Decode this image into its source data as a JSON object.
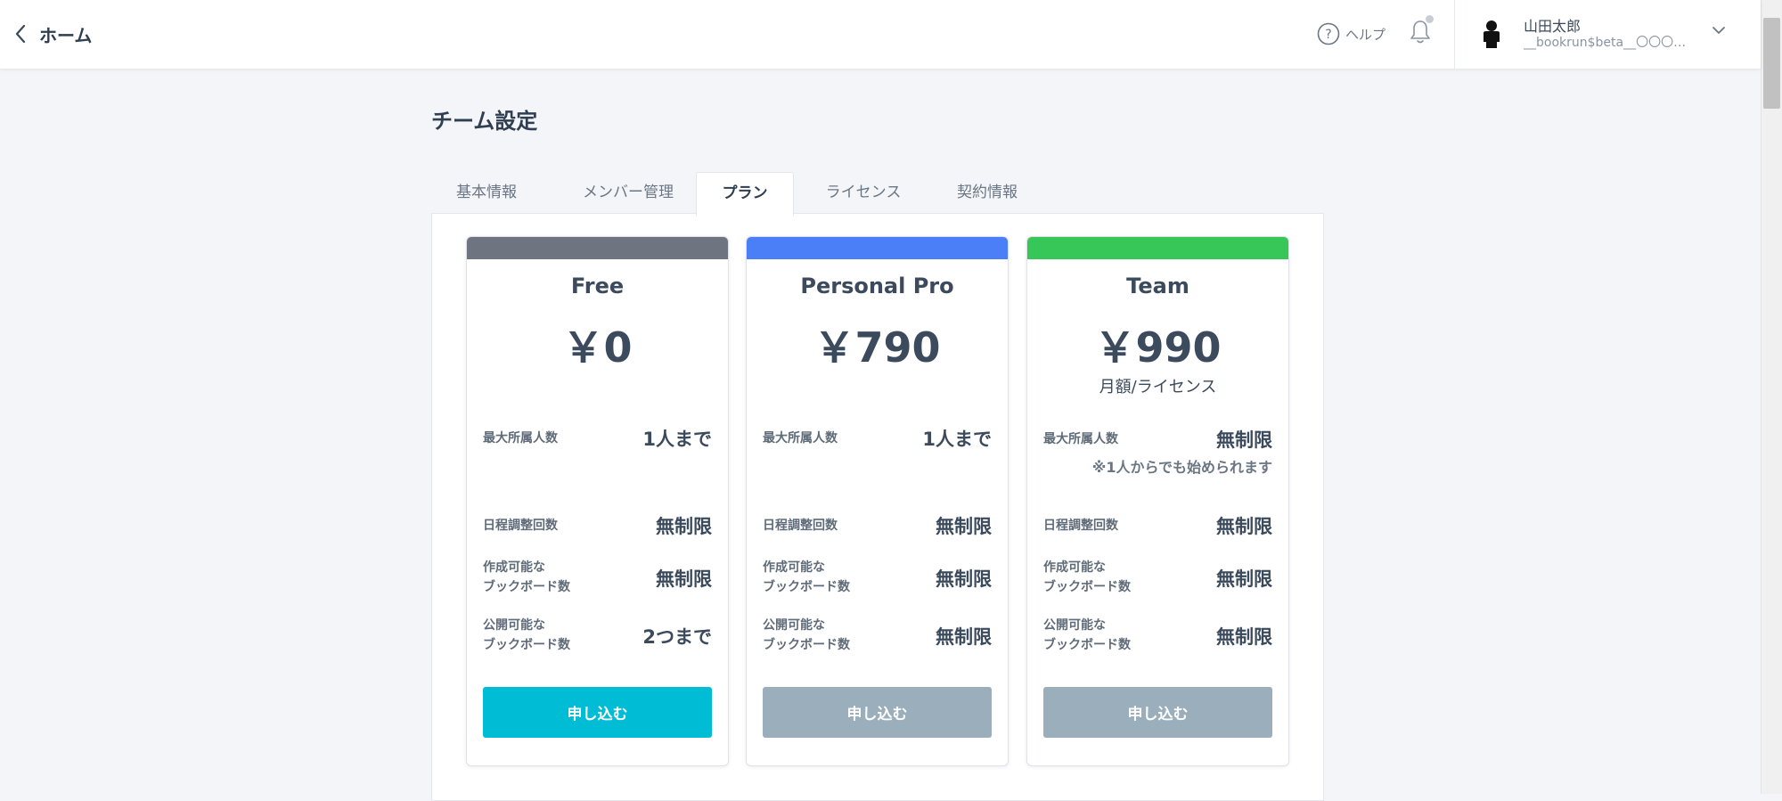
{
  "header": {
    "back_label": "ホーム",
    "help_label": "ヘルプ",
    "user_name": "山田太郎",
    "user_id": "__bookrun$beta__〇〇〇〇〇"
  },
  "page": {
    "title": "チーム設定"
  },
  "tabs": [
    {
      "label": "基本情報"
    },
    {
      "label": "メンバー管理"
    },
    {
      "label": "プラン",
      "active": true
    },
    {
      "label": "ライセンス"
    },
    {
      "label": "契約情報"
    }
  ],
  "row_labels": {
    "max_members": "最大所属人数",
    "schedule": "日程調整回数",
    "create_1": "作成可能な",
    "create_2": "ブックボード数",
    "public_1": "公開可能な",
    "public_2": "ブックボード数"
  },
  "plans": [
    {
      "name": "Free",
      "price": "￥0",
      "unit": "",
      "bar_color": "#6f7580",
      "max_members": "1人まで",
      "max_members_note": "",
      "schedule": "無制限",
      "create_boards": "無制限",
      "public_boards": "2つまで",
      "button_label": "申し込む",
      "button_state": "enabled"
    },
    {
      "name": "Personal Pro",
      "price": "￥790",
      "unit": "",
      "bar_color": "#4a7ff7",
      "max_members": "1人まで",
      "max_members_note": "",
      "schedule": "無制限",
      "create_boards": "無制限",
      "public_boards": "無制限",
      "button_label": "申し込む",
      "button_state": "disabled"
    },
    {
      "name": "Team",
      "price": "￥990",
      "unit": "月額/ライセンス",
      "bar_color": "#37c759",
      "max_members": "無制限",
      "max_members_note": "※1人からでも始められます",
      "schedule": "無制限",
      "create_boards": "無制限",
      "public_boards": "無制限",
      "button_label": "申し込む",
      "button_state": "disabled"
    }
  ],
  "colors": {
    "primary_button": "#00bcd4",
    "disabled_button": "#9aaebb"
  }
}
